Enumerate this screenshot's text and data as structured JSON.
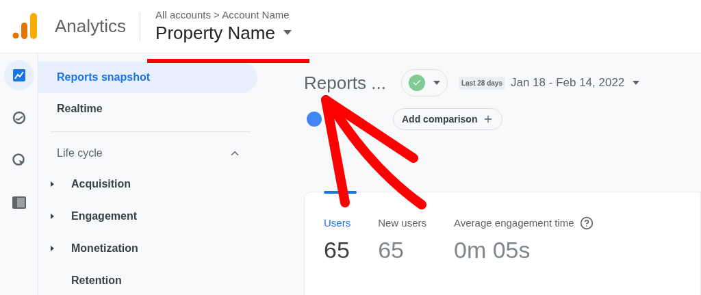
{
  "header": {
    "app_name": "Analytics",
    "breadcrumb": "All accounts > Account Name",
    "property": "Property Name"
  },
  "rail": [
    {
      "kind": "reports",
      "selected": true
    },
    {
      "kind": "explore",
      "selected": false
    },
    {
      "kind": "advertising",
      "selected": false
    },
    {
      "kind": "configure",
      "selected": false
    }
  ],
  "sidebar": {
    "items": [
      {
        "label": "Reports snapshot",
        "selected": true
      },
      {
        "label": "Realtime",
        "selected": false
      }
    ],
    "section": {
      "label": "Life cycle",
      "expanded": true,
      "children": [
        {
          "label": "Acquisition",
          "expandable": true
        },
        {
          "label": "Engagement",
          "expandable": true
        },
        {
          "label": "Monetization",
          "expandable": true
        },
        {
          "label": "Retention",
          "expandable": false
        }
      ]
    }
  },
  "toolbar": {
    "title": "Reports ...",
    "range_badge": "Last 28 days",
    "date_range": "Jan 18 - Feb 14, 2022",
    "comparison": "Add comparison"
  },
  "metrics": [
    {
      "label": "Users",
      "value": "65",
      "selected": true,
      "help": false
    },
    {
      "label": "New users",
      "value": "65",
      "selected": false,
      "help": false
    },
    {
      "label": "Average engagement time",
      "value": "0m 05s",
      "selected": false,
      "help": true
    }
  ],
  "annotations": {
    "underline": true,
    "arrow": true
  }
}
